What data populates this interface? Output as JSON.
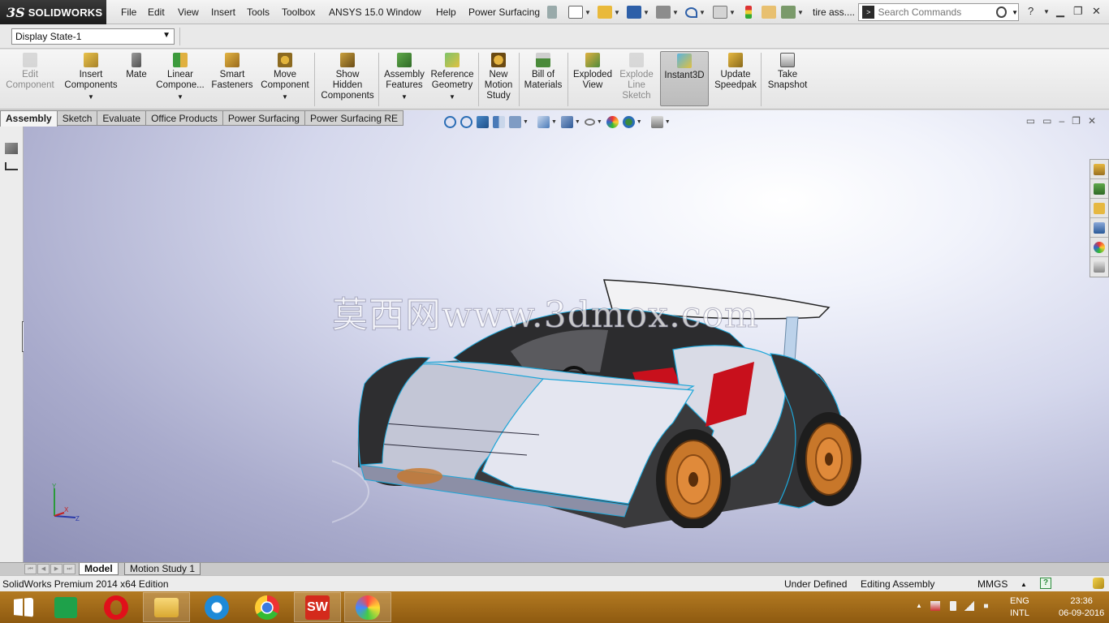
{
  "app": {
    "logo_ds": "3S",
    "logo_text": "SOLIDWORKS",
    "menu": [
      "File",
      "Edit",
      "View",
      "Insert",
      "Tools",
      "Toolbox",
      "ANSYS 15.0",
      "Window",
      "Help",
      "Power Surfacing"
    ],
    "doc_title": "tire ass....",
    "search_placeholder": "Search Commands",
    "help_label": "?"
  },
  "display_state": {
    "value": "Display State-1"
  },
  "command_manager": {
    "buttons": [
      {
        "label": "Edit Component",
        "lines": [
          "Edit",
          "Component"
        ],
        "icon": "edit-component-icon",
        "disabled": true
      },
      {
        "label": "Insert Components",
        "lines": [
          "Insert",
          "Components"
        ],
        "icon": "insert-components-icon",
        "dropdown": true
      },
      {
        "label": "Mate",
        "lines": [
          "Mate"
        ],
        "icon": "paperclip-icon"
      },
      {
        "label": "Linear Component...",
        "lines": [
          "Linear",
          "Compone..."
        ],
        "icon": "linear-pattern-icon",
        "dropdown": true
      },
      {
        "label": "Smart Fasteners",
        "lines": [
          "Smart",
          "Fasteners"
        ],
        "icon": "fasteners-icon"
      },
      {
        "label": "Move Component",
        "lines": [
          "Move",
          "Component"
        ],
        "icon": "move-component-icon",
        "dropdown": true
      },
      {
        "label": "Show Hidden Components",
        "lines": [
          "Show",
          "Hidden",
          "Components"
        ],
        "icon": "show-hidden-icon"
      },
      {
        "label": "Assembly Features",
        "lines": [
          "Assembly",
          "Features"
        ],
        "icon": "assembly-features-icon",
        "dropdown": true
      },
      {
        "label": "Reference Geometry",
        "lines": [
          "Reference",
          "Geometry"
        ],
        "icon": "reference-geometry-icon",
        "dropdown": true
      },
      {
        "label": "New Motion Study",
        "lines": [
          "New",
          "Motion",
          "Study"
        ],
        "icon": "motion-study-icon"
      },
      {
        "label": "Bill of Materials",
        "lines": [
          "Bill of",
          "Materials"
        ],
        "icon": "bom-icon"
      },
      {
        "label": "Exploded View",
        "lines": [
          "Exploded",
          "View"
        ],
        "icon": "exploded-view-icon"
      },
      {
        "label": "Explode Line Sketch",
        "lines": [
          "Explode",
          "Line",
          "Sketch"
        ],
        "icon": "explode-line-icon",
        "disabled": true
      },
      {
        "label": "Instant3D",
        "lines": [
          "Instant3D"
        ],
        "icon": "instant3d-icon",
        "active": true
      },
      {
        "label": "Update Speedpak",
        "lines": [
          "Update",
          "Speedpak"
        ],
        "icon": "speedpak-icon"
      },
      {
        "label": "Take Snapshot",
        "lines": [
          "Take",
          "Snapshot"
        ],
        "icon": "camera-icon"
      }
    ]
  },
  "tabs": [
    "Assembly",
    "Sketch",
    "Evaluate",
    "Office Products",
    "Power Surfacing",
    "Power Surfacing RE"
  ],
  "active_tab": "Assembly",
  "viewport": {
    "watermark": "莫西网www.3dmox.com",
    "triad_labels": {
      "x": "X",
      "y": "Y",
      "z": "Z"
    }
  },
  "bottom_tabs": [
    "Model",
    "Motion Study 1"
  ],
  "status_bar": {
    "edition": "SolidWorks Premium 2014 x64 Edition",
    "state": "Under Defined",
    "mode": "Editing Assembly",
    "units": "MMGS",
    "units_arrow": "▲",
    "help": "?"
  },
  "taskbar": {
    "apps": [
      "windows-start",
      "store",
      "opera",
      "file-explorer",
      "internet-explorer",
      "chrome",
      "solidworks",
      "paint"
    ],
    "sw_glyph": "SW",
    "lang": {
      "line1": "ENG",
      "line2": "INTL"
    },
    "clock": {
      "time": "23:36",
      "date": "06-09-2016"
    }
  },
  "colors": {
    "accent_blue": "#2a6db5",
    "car_edge": "#1ea6d8",
    "car_red": "#c8101c",
    "rim_orange": "#c8772a",
    "taskbar": "#a46a18"
  }
}
